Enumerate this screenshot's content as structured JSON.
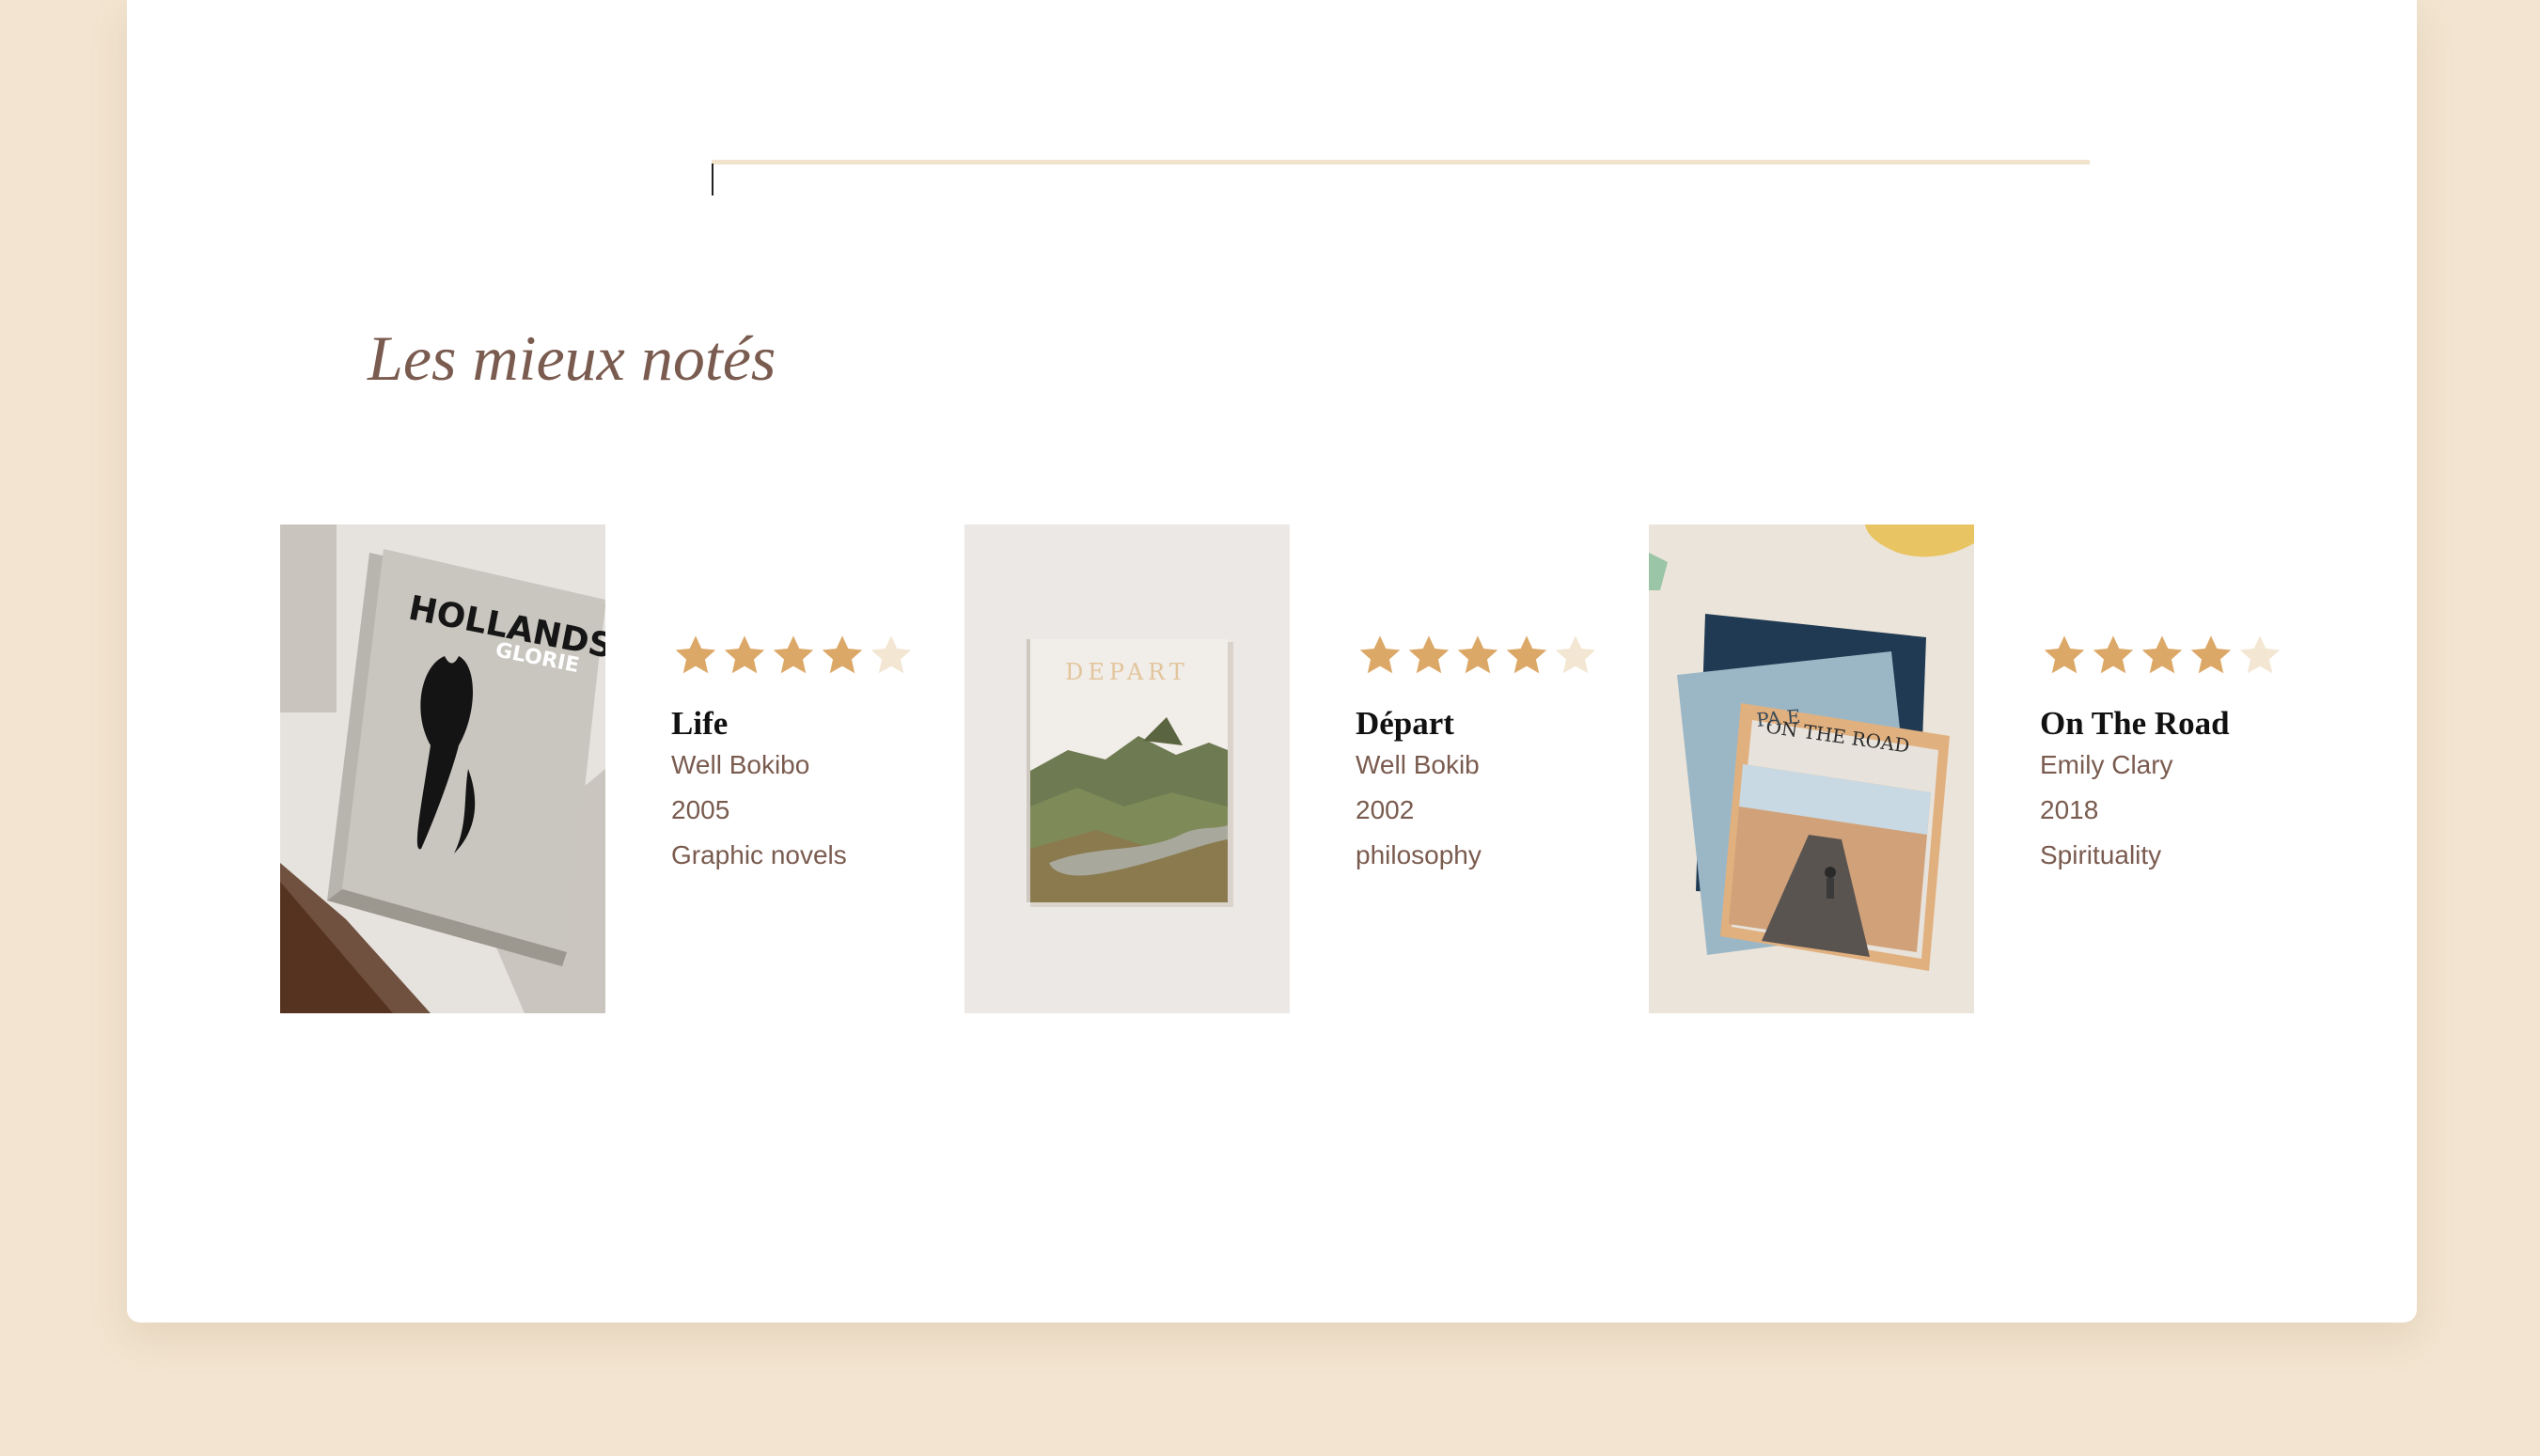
{
  "search": {
    "value": "",
    "placeholder": ""
  },
  "section": {
    "title": "Les mieux notés"
  },
  "colors": {
    "page_background": "#f2e4d0",
    "card_background": "#ffffff",
    "title_color": "#7a5b4f",
    "star_filled": "#dca867",
    "star_empty": "#f3e6d2",
    "search_line": "#f1e3cc"
  },
  "books": [
    {
      "title": "Life",
      "author": "Well Bokibo",
      "year": "2005",
      "genre": "Graphic novels",
      "rating": 4,
      "rating_max": 5,
      "cover_text": "HOLLANDS",
      "cover_subtext": "GLORIE"
    },
    {
      "title": "Départ",
      "author": "Well Bokib",
      "year": "2002",
      "genre": "philosophy",
      "rating": 4,
      "rating_max": 5,
      "cover_text": "DEPART"
    },
    {
      "title": "On The Road",
      "author": "Emily Clary",
      "year": "2018",
      "genre": "Spirituality",
      "rating": 4,
      "rating_max": 5,
      "cover_text": "ON THE ROAD",
      "cover_subtext": "PA    E"
    }
  ]
}
